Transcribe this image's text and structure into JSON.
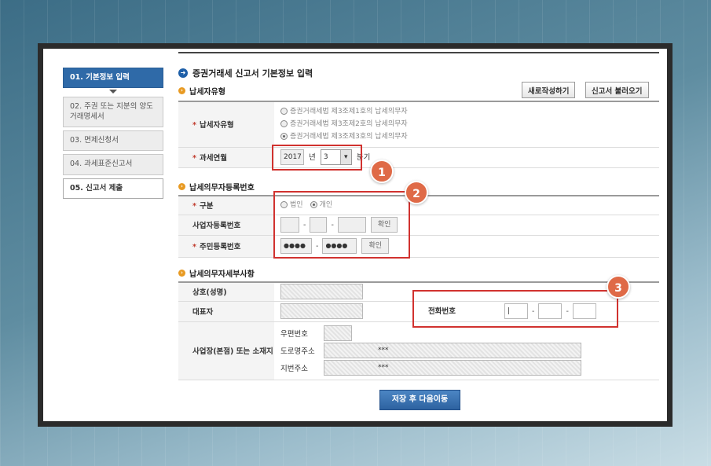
{
  "sidebar": {
    "steps": [
      {
        "label": "01. 기본정보 입력"
      },
      {
        "label": "02. 주권 또는 지분의 양도 거래명세서"
      },
      {
        "label": "03. 면제신청서"
      },
      {
        "label": "04. 과세표준신고서"
      },
      {
        "label": "05. 신고서 제출"
      }
    ]
  },
  "main": {
    "title": "증권거래세 신고서 기본정보 입력",
    "buttons": {
      "new": "새로작성하기",
      "load": "신고서 불러오기"
    },
    "section1": {
      "title": "납세자유형",
      "type_label": "납세자유형",
      "type_options": [
        "증권거래세법 제3조제1호의 납세의무자",
        "증권거래세법 제3조제2호의 납세의무자",
        "증권거래세법 제3조제3호의 납세의무자"
      ],
      "period_label": "과세연월",
      "year": "2017",
      "year_unit": "년",
      "quarter": "3",
      "quarter_unit": "분기"
    },
    "section2": {
      "title": "납세의무자등록번호",
      "kind_label": "구분",
      "kind_options": [
        "법인",
        "개인"
      ],
      "bizno_label": "사업자등록번호",
      "bizno_dash1": "-",
      "bizno_dash2": "-",
      "bizno_confirm": "확인",
      "resno_label": "주민등록번호",
      "resno_part1": "●●●●",
      "resno_part2": "●●●●",
      "resno_dash": "-",
      "resno_confirm": "확인"
    },
    "section3": {
      "title": "납세의무자세부사항",
      "company_label": "상호(성명)",
      "rep_label": "대표자",
      "phone_label": "전화번호",
      "phone_dash1": "-",
      "phone_dash2": "-",
      "addr_label": "사업장(본점) 또는 소재지",
      "zip_label": "우편번호",
      "road_label": "도로명주소",
      "road_value": "***",
      "jibun_label": "지번주소",
      "jibun_value": "***"
    },
    "submit": "저장 후 다음이동"
  },
  "annotations": {
    "badge1": "1",
    "badge2": "2",
    "badge3": "3"
  },
  "colors": {
    "accent": "#2f6aa8",
    "highlight": "#d1322f",
    "badge": "#df6a47",
    "section_dot": "#e89a22"
  }
}
